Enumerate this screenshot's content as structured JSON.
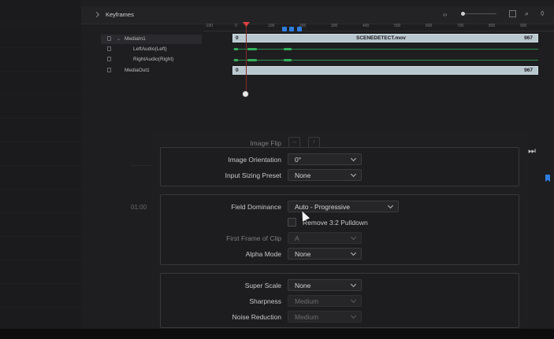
{
  "keyframes": {
    "title": "Keyframes",
    "tree": [
      {
        "label": "MediaIn1",
        "selected": true
      },
      {
        "label": "LeftAudio(Left)"
      },
      {
        "label": "RightAudio(Right)"
      },
      {
        "label": "MediaOut1"
      }
    ],
    "ruler": [
      "-100",
      "0",
      "100",
      "200",
      "300",
      "400",
      "500",
      "600",
      "700",
      "800",
      "900"
    ],
    "tracks": {
      "media_in": {
        "start": "0",
        "name": "SCENEDETECT.mov",
        "end": "967"
      },
      "media_out": {
        "start": "0",
        "end": "967"
      }
    }
  },
  "inspector": {
    "image_flip_label": "Image Flip",
    "image_orientation": {
      "label": "Image Orientation",
      "value": "0°"
    },
    "input_sizing": {
      "label": "Input Sizing Preset",
      "value": "None"
    },
    "field_dominance": {
      "label": "Field Dominance",
      "value": "Auto - Progressive"
    },
    "remove_pulldown": {
      "label": "Remove 3:2 Pulldown"
    },
    "first_frame": {
      "label": "First Frame of Clip",
      "value": "A"
    },
    "alpha_mode": {
      "label": "Alpha Mode",
      "value": "None"
    },
    "super_scale": {
      "label": "Super Scale",
      "value": "None"
    },
    "sharpness": {
      "label": "Sharpness",
      "value": "Medium"
    },
    "noise_reduction": {
      "label": "Noise Reduction",
      "value": "Medium"
    }
  },
  "timecode": "01:00"
}
